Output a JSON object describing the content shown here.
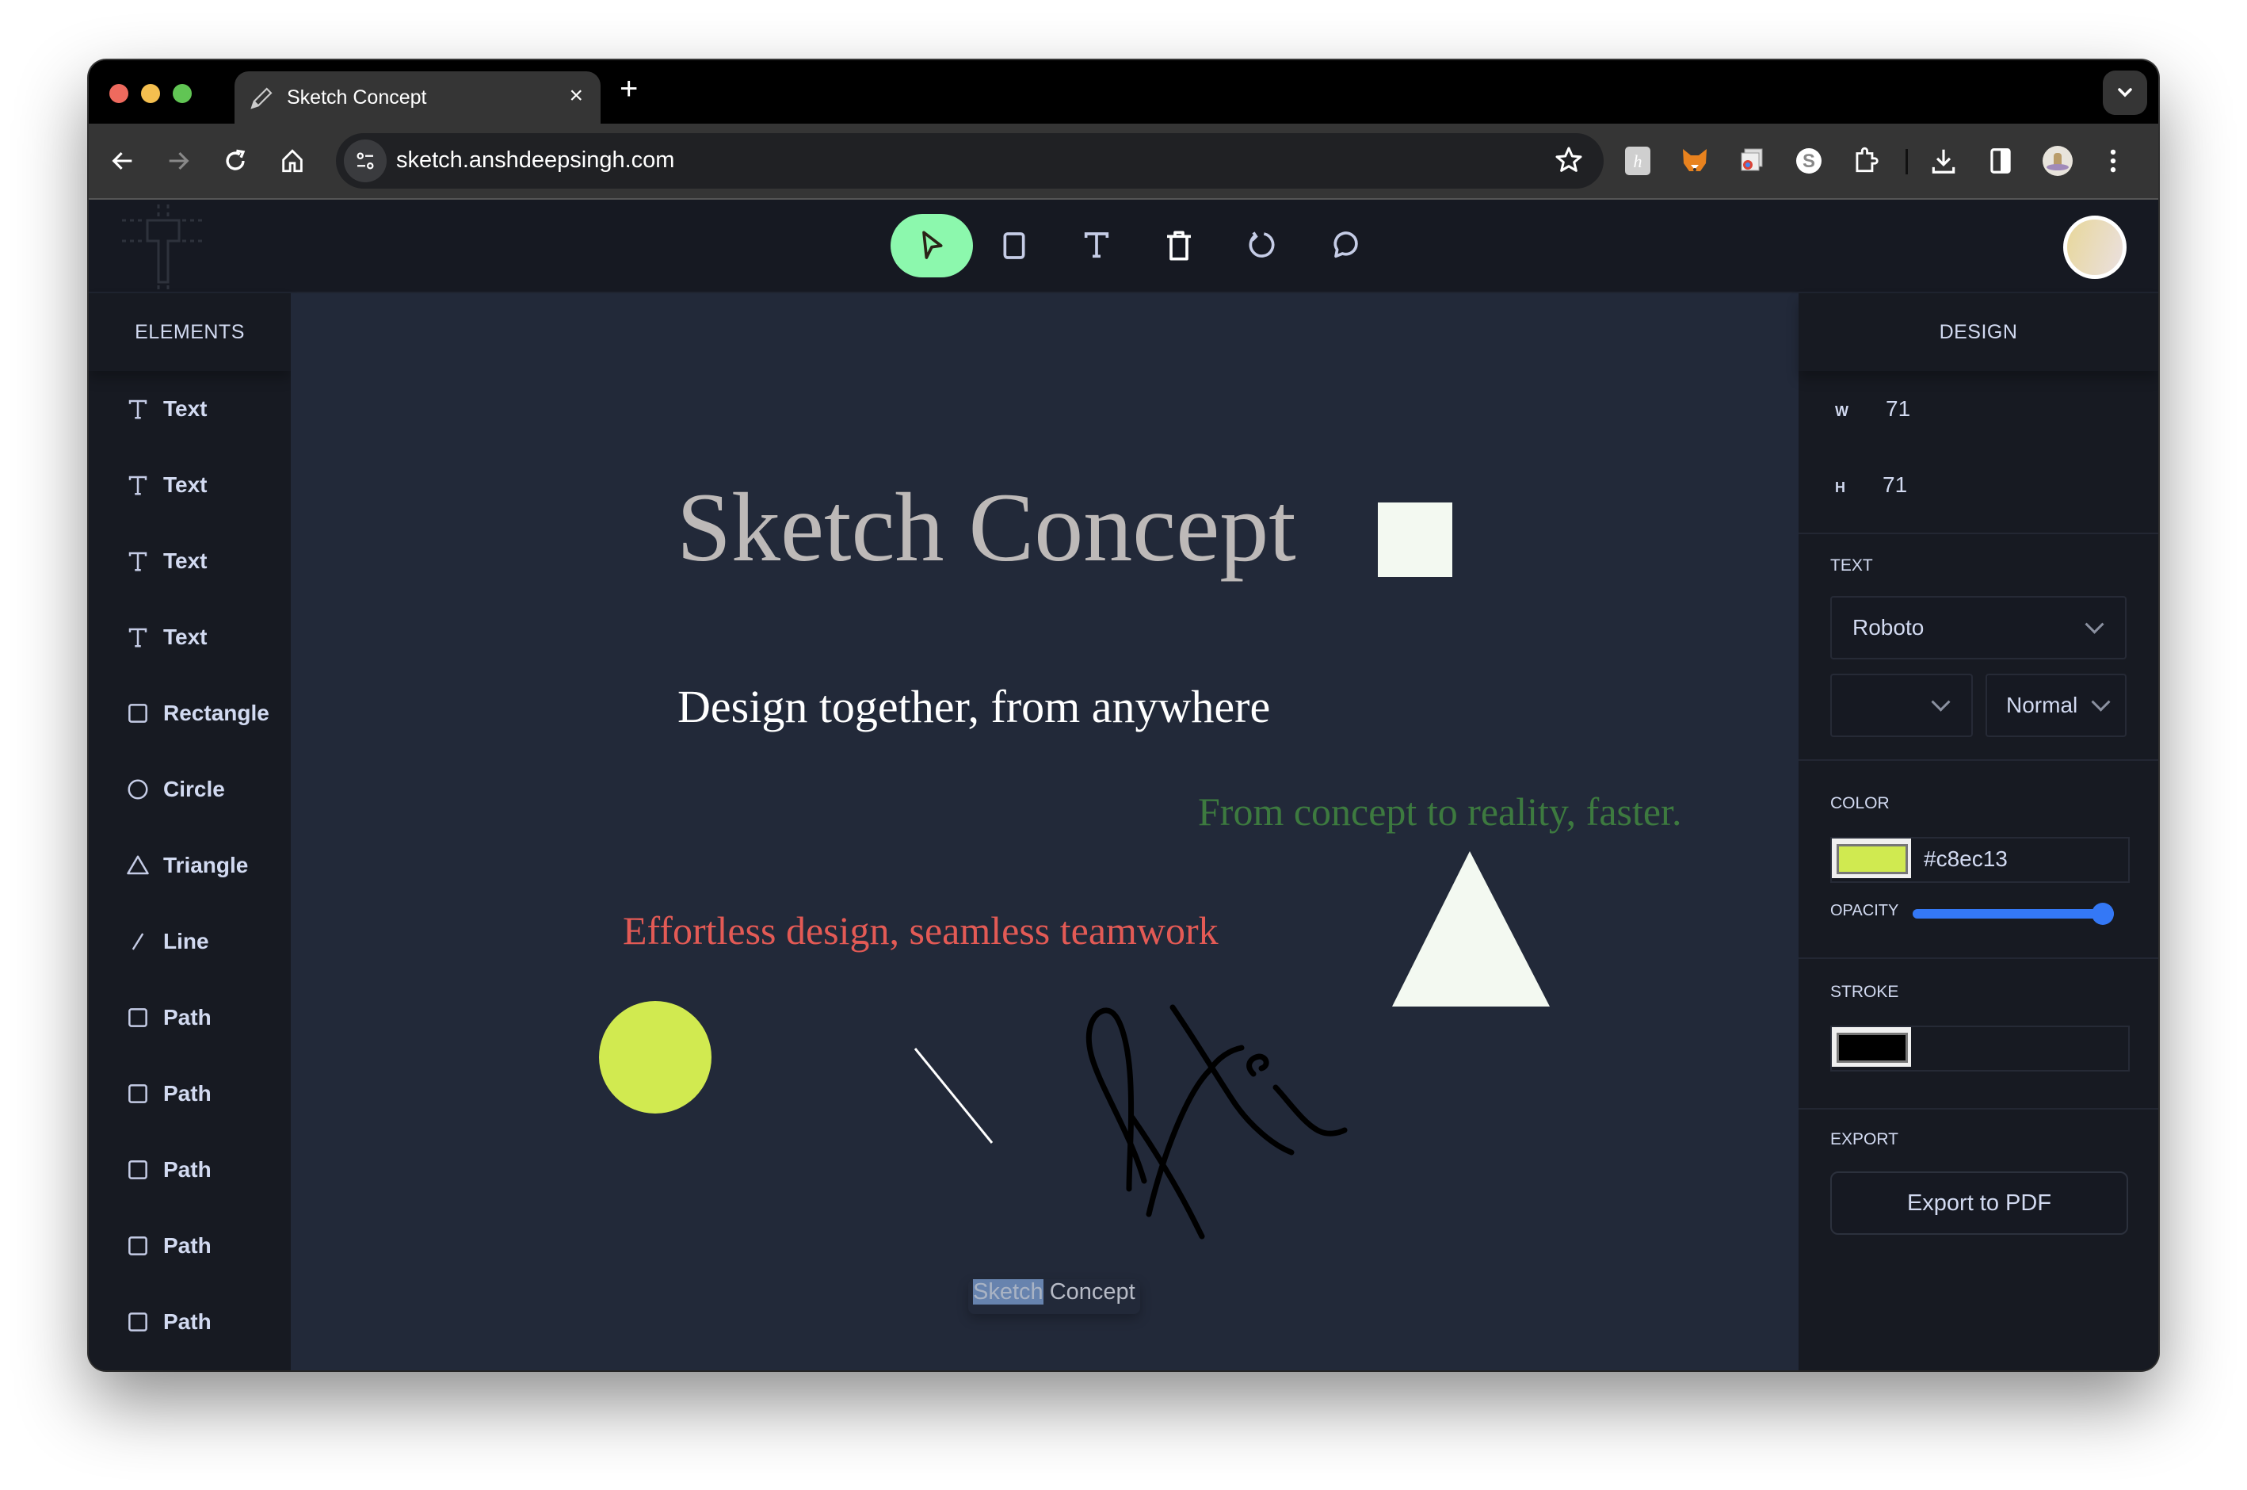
{
  "browser": {
    "tab_title": "Sketch Concept",
    "tab_close": "×",
    "new_tab": "+",
    "url": "sketch.anshdeepsingh.com",
    "extensions": [
      "h-extension-icon",
      "metamask-fox-icon",
      "chrome-tabs-icon",
      "s-extension-icon",
      "puzzle-extensions-icon"
    ]
  },
  "toolbar": {
    "tools": [
      {
        "name": "select",
        "active": true
      },
      {
        "name": "rectangle",
        "active": false
      },
      {
        "name": "text",
        "active": false
      },
      {
        "name": "delete",
        "active": false
      },
      {
        "name": "reset",
        "active": false
      },
      {
        "name": "comment",
        "active": false
      }
    ]
  },
  "sidebar": {
    "title": "ELEMENTS",
    "items": [
      {
        "label": "Text",
        "icon": "text-icon"
      },
      {
        "label": "Text",
        "icon": "text-icon"
      },
      {
        "label": "Text",
        "icon": "text-icon"
      },
      {
        "label": "Text",
        "icon": "text-icon"
      },
      {
        "label": "Rectangle",
        "icon": "rectangle-icon"
      },
      {
        "label": "Circle",
        "icon": "circle-icon"
      },
      {
        "label": "Triangle",
        "icon": "triangle-icon"
      },
      {
        "label": "Line",
        "icon": "line-icon"
      },
      {
        "label": "Path",
        "icon": "path-icon"
      },
      {
        "label": "Path",
        "icon": "path-icon"
      },
      {
        "label": "Path",
        "icon": "path-icon"
      },
      {
        "label": "Path",
        "icon": "path-icon"
      },
      {
        "label": "Path",
        "icon": "path-icon"
      }
    ]
  },
  "canvas": {
    "heading": "Sketch Concept",
    "subheading": "Design together, from anywhere",
    "green_text": "From concept to reality, faster.",
    "red_text": "Effortless design, seamless teamwork",
    "colors": {
      "background": "#222939",
      "heading": "#bdb9b8",
      "subheading": "#ffffff",
      "green_text": "#3d7a3f",
      "red_text": "#e35a55",
      "square": "#f3f9f1",
      "triangle": "#f3f9f1",
      "circle": "#d1ea50",
      "line": "#ffffff",
      "path": "#000000"
    },
    "bottom_label_selected": "Sketch",
    "bottom_label_rest": " Concept"
  },
  "design": {
    "title": "DESIGN",
    "w_label": "W",
    "w_value": "71",
    "h_label": "H",
    "h_value": "71",
    "text_label": "TEXT",
    "font_family": "Roboto",
    "font_size": "",
    "font_weight": "Normal",
    "color_label": "COLOR",
    "color_value": "#c8ec13",
    "opacity_label": "OPACITY",
    "opacity_percent": 100,
    "stroke_label": "STROKE",
    "stroke_color": "#000000",
    "export_label": "EXPORT",
    "export_button": "Export to PDF"
  }
}
